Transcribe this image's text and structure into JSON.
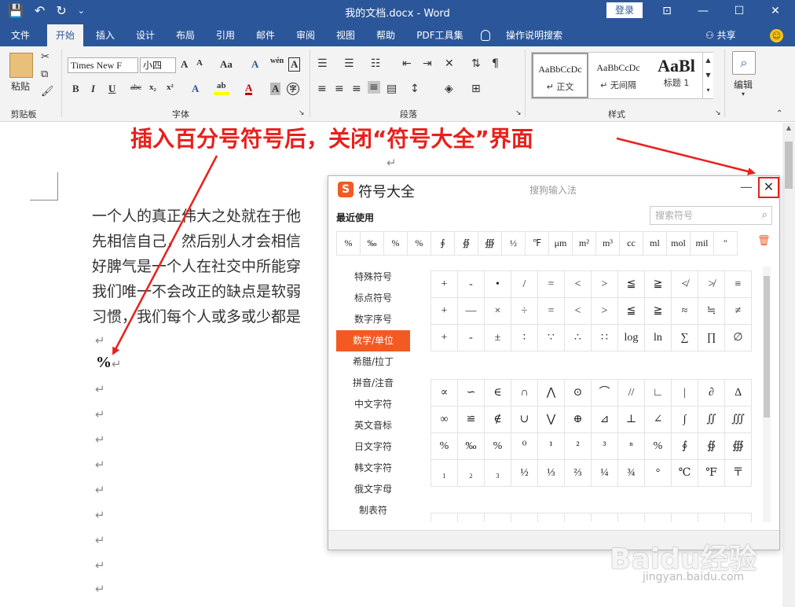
{
  "titlebar": {
    "doc_title": "我的文档.docx - Word",
    "login": "登录",
    "qat": [
      "💾",
      "↶",
      "↻",
      "⌄"
    ],
    "win_controls": [
      "⊡",
      "—",
      "☐",
      "✕"
    ]
  },
  "tabs": [
    "文件",
    "开始",
    "插入",
    "设计",
    "布局",
    "引用",
    "邮件",
    "审阅",
    "视图",
    "帮助",
    "PDF工具集",
    "操作说明搜索"
  ],
  "share": "共享",
  "ribbon": {
    "clipboard": {
      "paste": "粘贴",
      "label": "剪贴板"
    },
    "font": {
      "name": "Times New F",
      "size": "小四",
      "label": "字体",
      "buttons": [
        "B",
        "I",
        "U",
        "abc",
        "x₂",
        "x²"
      ],
      "icons": [
        "A",
        "wén",
        "A",
        "Aa",
        "A",
        "A",
        "A",
        "A"
      ]
    },
    "paragraph": {
      "label": "段落"
    },
    "styles": {
      "label": "样式",
      "items": [
        {
          "sample": "AaBbCcDc",
          "name": "↵ 正文"
        },
        {
          "sample": "AaBbCcDc",
          "name": "↵ 无间隔"
        },
        {
          "sample": "AaBl",
          "name": "标题 1"
        }
      ]
    },
    "editing": {
      "label": "编辑"
    }
  },
  "document": {
    "lines": [
      "一个人的真正伟大之处就在于他",
      "先相信自己，然后别人才会相信",
      "好脾气是一个人在社交中所能穿",
      "我们唯一不会改正的缺点是软弱",
      "习惯，我们每个人或多或少都是"
    ],
    "para_mark": "↵",
    "percent": "%"
  },
  "annotation": "插入百分号符号后，关闭“符号大全”界面",
  "dialog": {
    "title": "符号大全",
    "ime": "搜狗输入法",
    "logo": "S",
    "minimize": "—",
    "close": "✕",
    "recent_label": "最近使用",
    "search_placeholder": "搜索符号",
    "recent": [
      "%",
      "‰",
      "%",
      "%",
      "∮",
      "∯",
      "∰",
      "½",
      "℉",
      "μm",
      "m²",
      "m³",
      "cc",
      "ml",
      "mol",
      "mil",
      "″"
    ],
    "categories": [
      "特殊符号",
      "标点符号",
      "数字序号",
      "数学/单位",
      "希腊/拉丁",
      "拼音/注音",
      "中文字符",
      "英文音标",
      "日文字符",
      "韩文字符",
      "俄文字母",
      "制表符"
    ],
    "active_category": "数学/单位",
    "grid1": [
      "+",
      "-",
      "•",
      "/",
      "=",
      "<",
      ">",
      "≦",
      "≧",
      "≮",
      "≯",
      "≡",
      "+",
      "—",
      "×",
      "÷",
      "=",
      "<",
      ">",
      "≦",
      "≧",
      "≈",
      "≒",
      "≠",
      "+",
      "-",
      "±",
      "∶",
      "∵",
      "∴",
      "∷",
      "log",
      "ln",
      "∑",
      "∏",
      "∅"
    ],
    "grid2": [
      "∝",
      "∽",
      "∈",
      "∩",
      "⋀",
      "⊙",
      "⌒",
      "//",
      "∟",
      "|",
      "∂",
      "∆",
      "∞",
      "≌",
      "∉",
      "∪",
      "⋁",
      "⊕",
      "⊿",
      "⊥",
      "∠",
      "∫",
      "∬",
      "∭",
      "%",
      "‰",
      "%",
      "⁰",
      "¹",
      "²",
      "³",
      "ⁿ",
      "%",
      "∮",
      "∯",
      "∰",
      "₁",
      "₂",
      "₃",
      "½",
      "⅓",
      "⅔",
      "¼",
      "¾",
      "°",
      "℃",
      "℉",
      "〒"
    ]
  },
  "watermark": {
    "text": "Baidu经验",
    "url": "jingyan.baidu.com"
  }
}
